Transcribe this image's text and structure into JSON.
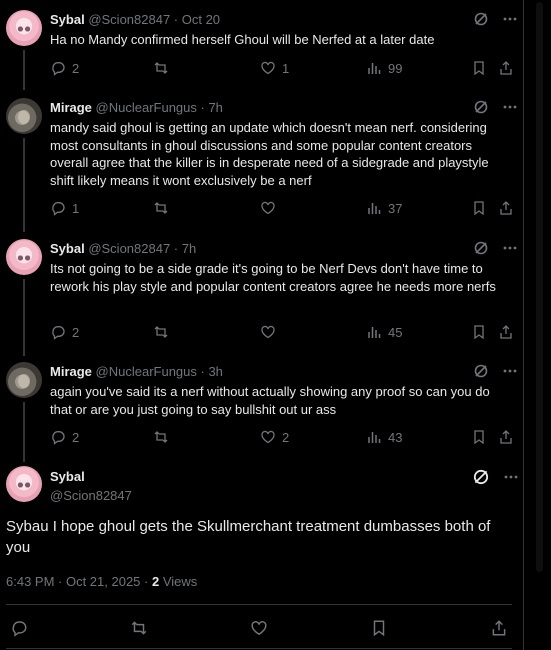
{
  "replies": [
    {
      "name": "Sybal",
      "handle": "@Scion82847",
      "time": " · Oct 20",
      "text": "Ha no Mandy confirmed herself Ghoul will be Nerfed at a later date",
      "replies": "2",
      "reposts": "",
      "likes": "1",
      "views": "99",
      "avatar": "pink"
    },
    {
      "name": "Mirage",
      "handle": "@NuclearFungus",
      "time": " · 7h",
      "text": "mandy said ghoul is getting an update which doesn't mean nerf. considering most consultants in ghoul discussions and some popular content creators overall agree that the killer is in desperate need of a sidegrade and playstyle shift likely means it wont exclusively be a nerf",
      "replies": "1",
      "reposts": "",
      "likes": "",
      "views": "37",
      "avatar": "gray"
    },
    {
      "name": "Sybal",
      "handle": "@Scion82847",
      "time": " · 7h",
      "text": "Its not going to be a side grade it's going to be Nerf Devs don't have time to rework his play style and popular content creators agree he needs more nerfs",
      "replies": "2",
      "reposts": "",
      "likes": "",
      "views": "45",
      "avatar": "pink"
    },
    {
      "name": "Mirage",
      "handle": "@NuclearFungus",
      "time": " · 3h",
      "text": "again you've said its a nerf without actually showing any proof so can you do that or are you just going to say bullshit out ur ass",
      "replies": "2",
      "reposts": "",
      "likes": "2",
      "views": "43",
      "avatar": "gray"
    }
  ],
  "main_tweet": {
    "name": "Sybal",
    "handle": "@Scion82847",
    "text": "Sybau I hope ghoul gets the Skullmerchant treatment dumbasses both of you",
    "time": "6:43 PM · Oct 21, 2025 · ",
    "views_count": "2",
    "views_label": " Views"
  },
  "icons": {
    "reply": "reply-icon",
    "repost": "repost-icon",
    "like": "like-icon",
    "views": "views-icon",
    "bookmark": "bookmark-icon",
    "share": "share-icon",
    "grok": "grok-icon",
    "more": "more-icon"
  },
  "colors": {
    "background": "#000000",
    "text": "#e7e9ea",
    "muted": "#71767b",
    "border": "#2f3336"
  }
}
